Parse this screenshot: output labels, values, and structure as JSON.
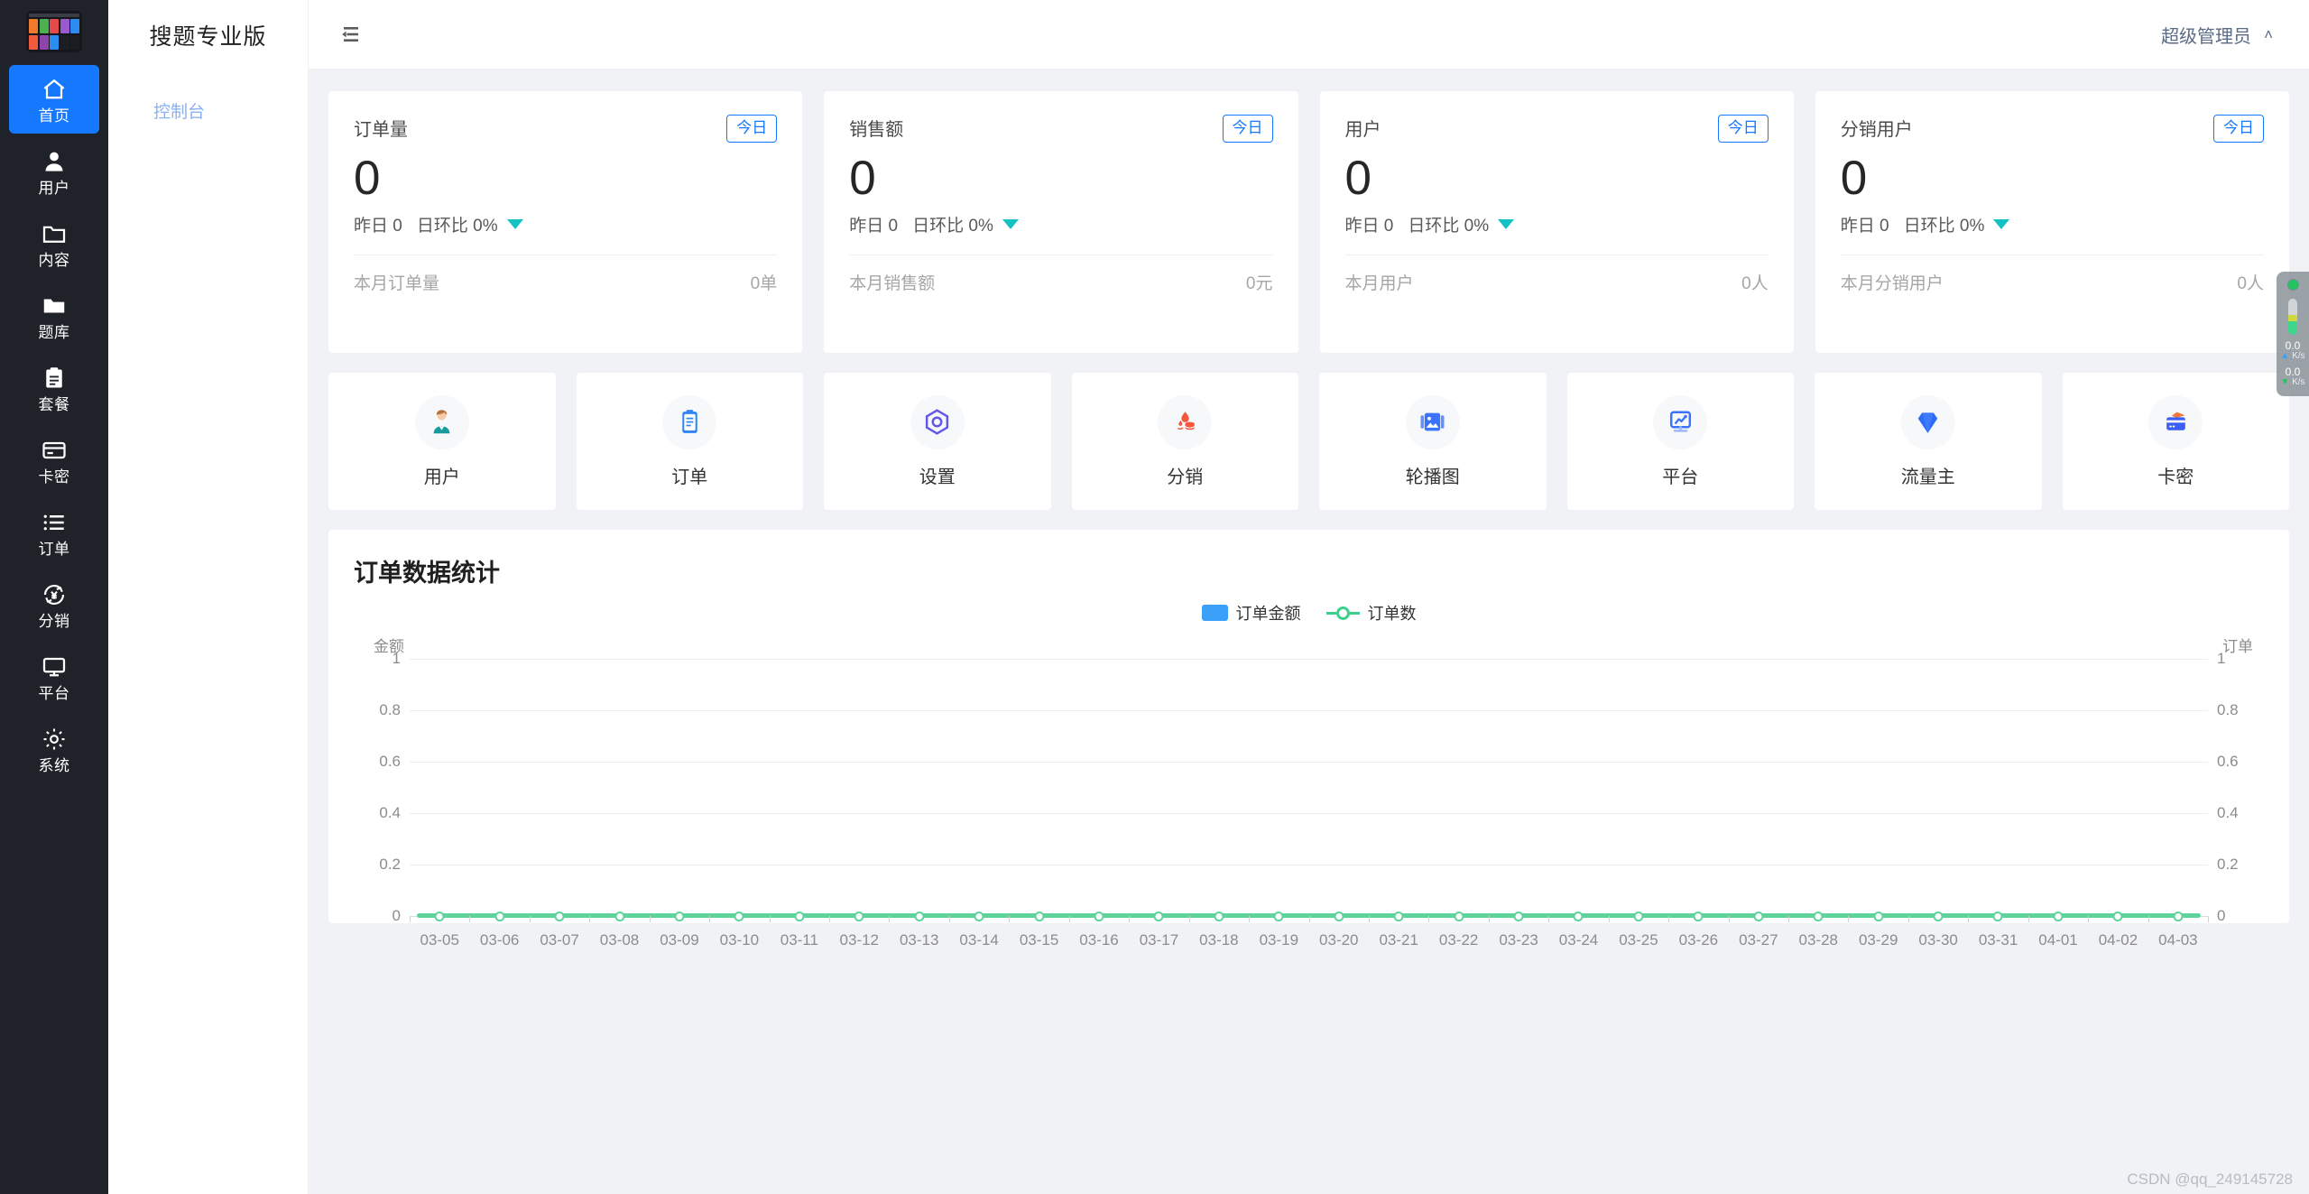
{
  "rail": {
    "logo_name": "app-grid-logo",
    "items": [
      {
        "label": "首页",
        "icon": "home-icon",
        "active": true
      },
      {
        "label": "用户",
        "icon": "user-icon",
        "active": false
      },
      {
        "label": "内容",
        "icon": "folder-open-icon",
        "active": false
      },
      {
        "label": "题库",
        "icon": "folder-icon",
        "active": false
      },
      {
        "label": "套餐",
        "icon": "clipboard-icon",
        "active": false
      },
      {
        "label": "卡密",
        "icon": "credit-card-icon",
        "active": false
      },
      {
        "label": "订单",
        "icon": "list-icon",
        "active": false
      },
      {
        "label": "分销",
        "icon": "yen-refresh-icon",
        "active": false
      },
      {
        "label": "平台",
        "icon": "monitor-icon",
        "active": false
      },
      {
        "label": "系统",
        "icon": "gear-icon",
        "active": false
      }
    ]
  },
  "subnav": {
    "brand": "搜题专业版",
    "items": [
      {
        "label": "控制台"
      }
    ]
  },
  "topbar": {
    "fold_icon": "menu-fold-icon",
    "user_name": "超级管理员",
    "chevron": "˄"
  },
  "stats": [
    {
      "title": "订单量",
      "tag": "今日",
      "value": "0",
      "yesterday_label": "昨日 0",
      "compare_label": "日环比 0%",
      "trend": "down",
      "foot_label": "本月订单量",
      "foot_value": "0单"
    },
    {
      "title": "销售额",
      "tag": "今日",
      "value": "0",
      "yesterday_label": "昨日 0",
      "compare_label": "日环比 0%",
      "trend": "down",
      "foot_label": "本月销售额",
      "foot_value": "0元"
    },
    {
      "title": "用户",
      "tag": "今日",
      "value": "0",
      "yesterday_label": "昨日 0",
      "compare_label": "日环比 0%",
      "trend": "down",
      "foot_label": "本月用户",
      "foot_value": "0人"
    },
    {
      "title": "分销用户",
      "tag": "今日",
      "value": "0",
      "yesterday_label": "昨日 0",
      "compare_label": "日环比 0%",
      "trend": "down",
      "foot_label": "本月分销用户",
      "foot_value": "0人"
    }
  ],
  "tiles": [
    {
      "label": "用户",
      "icon": "avatar-person-icon"
    },
    {
      "label": "订单",
      "icon": "clipboard-list-icon"
    },
    {
      "label": "设置",
      "icon": "hex-gear-icon"
    },
    {
      "label": "分销",
      "icon": "coins-drop-icon"
    },
    {
      "label": "轮播图",
      "icon": "image-carousel-icon"
    },
    {
      "label": "平台",
      "icon": "monitor-chart-icon"
    },
    {
      "label": "流量主",
      "icon": "diamond-pin-icon"
    },
    {
      "label": "卡密",
      "icon": "wallet-card-icon"
    }
  ],
  "chart_panel": {
    "title": "订单数据统计"
  },
  "chart_data": {
    "type": "line",
    "title": "订单数据统计",
    "xlabel": "",
    "ylabel": "金额",
    "y2label": "订单",
    "ylim": [
      0,
      1
    ],
    "y2lim": [
      0,
      1
    ],
    "yticks": [
      "1",
      "0.8",
      "0.6",
      "0.4",
      "0.2",
      "0"
    ],
    "y2ticks": [
      "1",
      "0.8",
      "0.6",
      "0.4",
      "0.2",
      "0"
    ],
    "grid": true,
    "legend_position": "top-center",
    "legend": [
      "订单金额",
      "订单数"
    ],
    "colors": {
      "bar": "#3ba0f8",
      "line": "#3ecf8e"
    },
    "categories": [
      "03-05",
      "03-06",
      "03-07",
      "03-08",
      "03-09",
      "03-10",
      "03-11",
      "03-12",
      "03-13",
      "03-14",
      "03-15",
      "03-16",
      "03-17",
      "03-18",
      "03-19",
      "03-20",
      "03-21",
      "03-22",
      "03-23",
      "03-24",
      "03-25",
      "03-26",
      "03-27",
      "03-28",
      "03-29",
      "03-30",
      "03-31",
      "04-01",
      "04-02",
      "04-03"
    ],
    "series": [
      {
        "name": "订单金额",
        "type": "bar",
        "axis": "left",
        "values": [
          0,
          0,
          0,
          0,
          0,
          0,
          0,
          0,
          0,
          0,
          0,
          0,
          0,
          0,
          0,
          0,
          0,
          0,
          0,
          0,
          0,
          0,
          0,
          0,
          0,
          0,
          0,
          0,
          0,
          0
        ]
      },
      {
        "name": "订单数",
        "type": "line",
        "axis": "right",
        "values": [
          0,
          0,
          0,
          0,
          0,
          0,
          0,
          0,
          0,
          0,
          0,
          0,
          0,
          0,
          0,
          0,
          0,
          0,
          0,
          0,
          0,
          0,
          0,
          0,
          0,
          0,
          0,
          0,
          0,
          0
        ]
      }
    ]
  },
  "net_widget": {
    "status_dot": "green",
    "upload_value": "0.0",
    "upload_unit": "K/s",
    "download_value": "0.0",
    "download_unit": "K/s"
  },
  "watermark": "CSDN @qq_249145728"
}
